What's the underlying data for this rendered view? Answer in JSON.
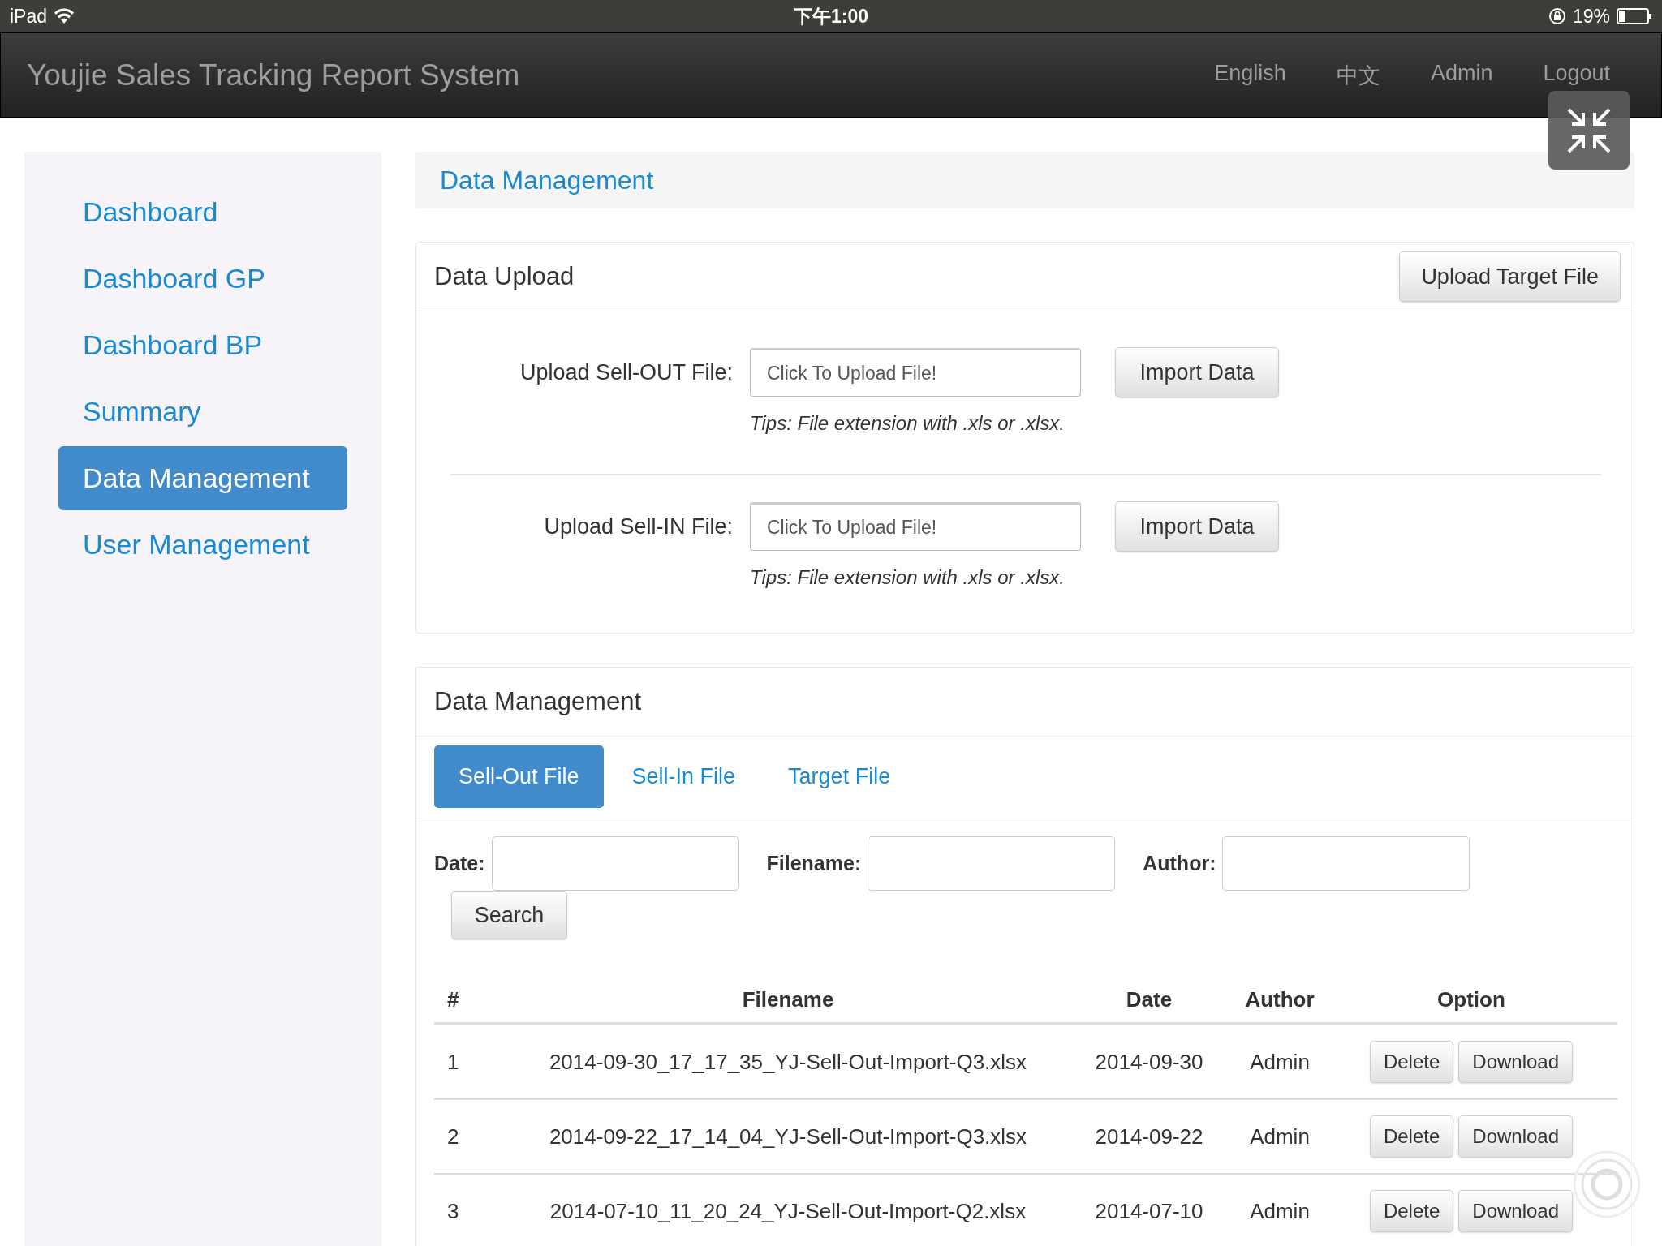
{
  "status_bar": {
    "device": "iPad",
    "time": "下午1:00",
    "battery": "19%"
  },
  "navbar": {
    "title": "Youjie Sales Tracking Report System",
    "links": [
      "English",
      "中文",
      "Admin",
      "Logout"
    ]
  },
  "sidebar": {
    "items": [
      {
        "label": "Dashboard",
        "selected": false
      },
      {
        "label": "Dashboard GP",
        "selected": false
      },
      {
        "label": "Dashboard BP",
        "selected": false
      },
      {
        "label": "Summary",
        "selected": false
      },
      {
        "label": "Data Management",
        "selected": true
      },
      {
        "label": "User Management",
        "selected": false
      }
    ]
  },
  "page_header": "Data Management",
  "upload_panel": {
    "title": "Data Upload",
    "button": "Upload Target File",
    "rows": [
      {
        "label": "Upload Sell-OUT File:",
        "placeholder": "Click To Upload File!",
        "button": "Import Data",
        "tip": "Tips: File extension with .xls or .xlsx."
      },
      {
        "label": "Upload Sell-IN File:",
        "placeholder": "Click To Upload File!",
        "button": "Import Data",
        "tip": "Tips: File extension with .xls or .xlsx."
      }
    ]
  },
  "manage_panel": {
    "title": "Data Management",
    "tabs": [
      {
        "label": "Sell-Out File",
        "selected": true
      },
      {
        "label": "Sell-In File",
        "selected": false
      },
      {
        "label": "Target File",
        "selected": false
      }
    ],
    "filters": [
      {
        "label": "Date:"
      },
      {
        "label": "Filename:"
      },
      {
        "label": "Author:"
      }
    ],
    "search_button": "Search",
    "table": {
      "columns": [
        "#",
        "Filename",
        "Date",
        "Author",
        "Option"
      ],
      "rows": [
        {
          "cells": [
            "1",
            "2014-09-30_17_17_35_YJ-Sell-Out-Import-Q3.xlsx",
            "2014-09-30",
            "Admin"
          ],
          "actions": [
            "Delete",
            "Download"
          ]
        },
        {
          "cells": [
            "2",
            "2014-09-22_17_14_04_YJ-Sell-Out-Import-Q3.xlsx",
            "2014-09-22",
            "Admin"
          ],
          "actions": [
            "Delete",
            "Download"
          ]
        },
        {
          "cells": [
            "3",
            "2014-07-10_11_20_24_YJ-Sell-Out-Import-Q2.xlsx",
            "2014-07-10",
            "Admin"
          ],
          "actions": [
            "Delete",
            "Download"
          ]
        }
      ]
    }
  }
}
